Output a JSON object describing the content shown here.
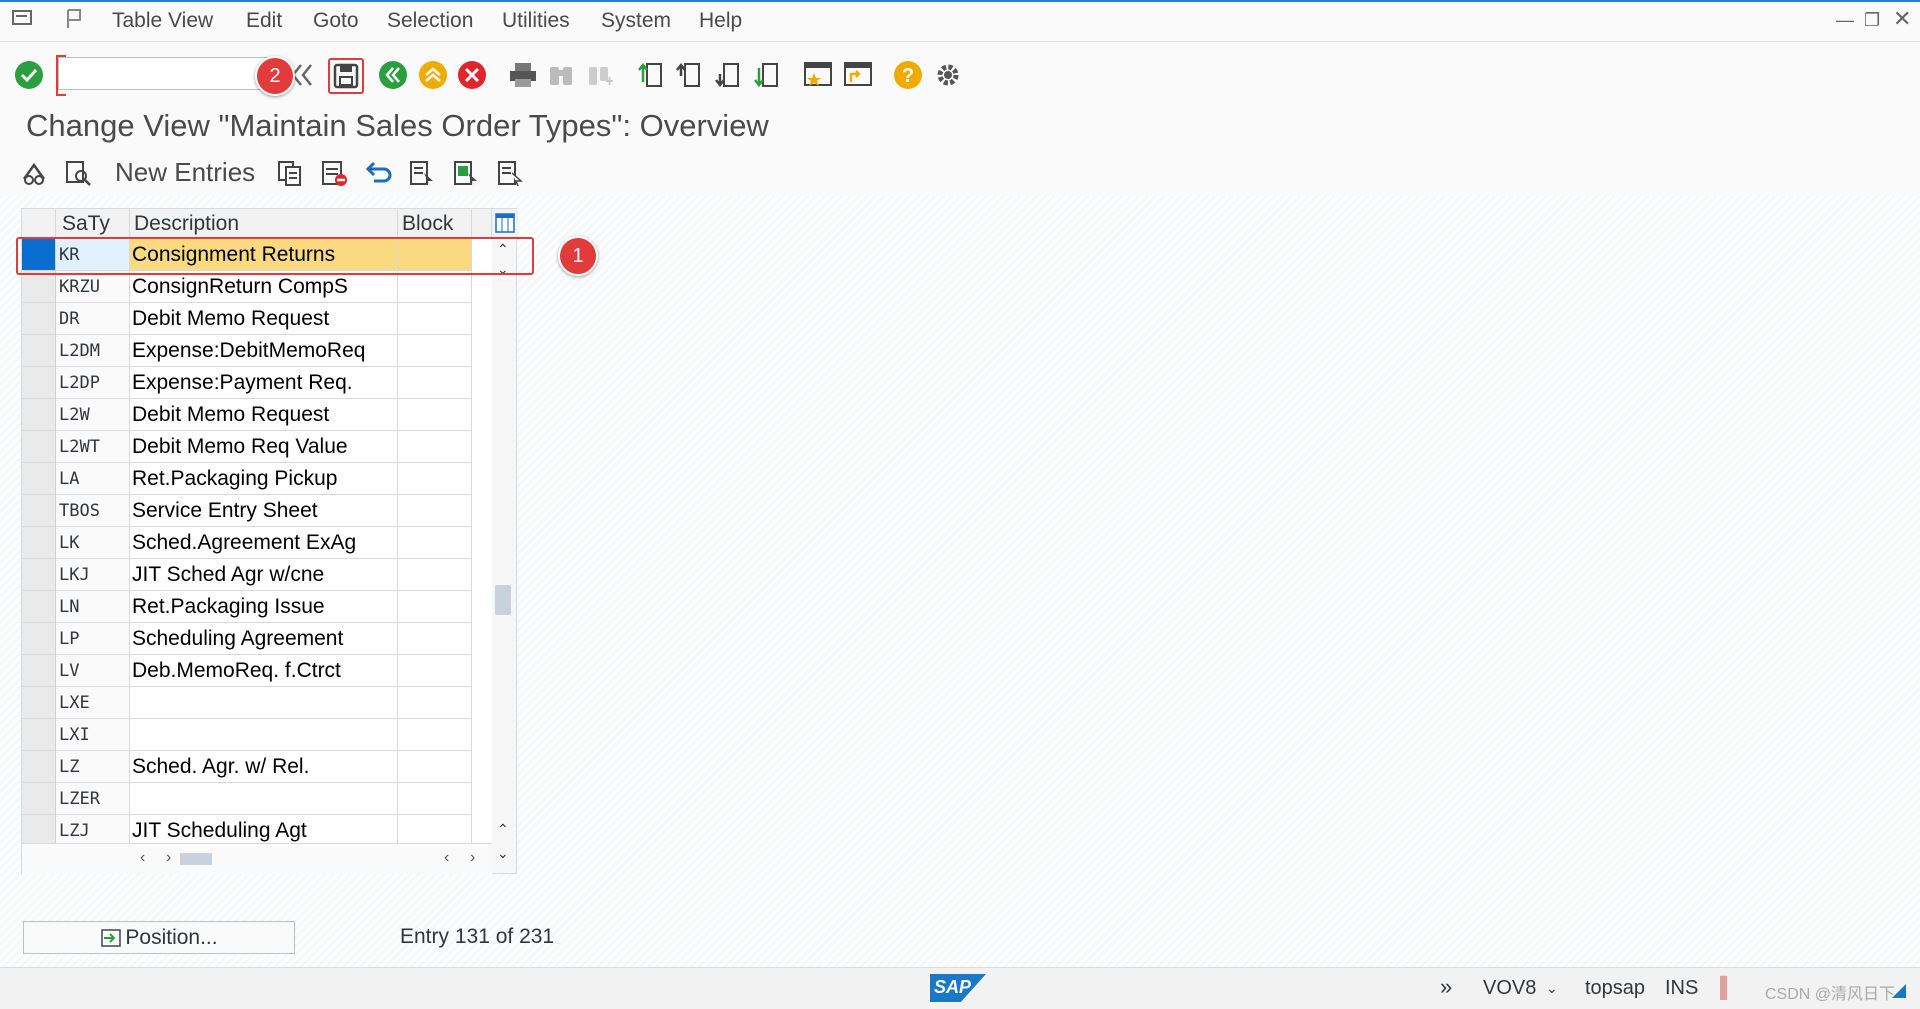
{
  "menu": {
    "items": [
      "Table View",
      "Edit",
      "Goto",
      "Selection",
      "Utilities",
      "System",
      "Help"
    ]
  },
  "command_field": {
    "value": "",
    "placeholder": ""
  },
  "badges": {
    "save": "2",
    "row": "1"
  },
  "title": "Change View \"Maintain Sales Order Types\": Overview",
  "app_toolbar": {
    "new_entries": "New Entries"
  },
  "table": {
    "headers": [
      "SaTy",
      "Description",
      "Block"
    ],
    "rows": [
      {
        "saty": "KR",
        "desc": "Consignment Returns",
        "block": ""
      },
      {
        "saty": "KRZU",
        "desc": "ConsignReturn CompS",
        "block": ""
      },
      {
        "saty": "DR",
        "desc": "Debit Memo Request",
        "block": ""
      },
      {
        "saty": "L2DM",
        "desc": "Expense:DebitMemoReq",
        "block": ""
      },
      {
        "saty": "L2DP",
        "desc": "Expense:Payment Req.",
        "block": ""
      },
      {
        "saty": "L2W",
        "desc": "Debit Memo Request",
        "block": ""
      },
      {
        "saty": "L2WT",
        "desc": "Debit Memo Req Value",
        "block": ""
      },
      {
        "saty": "LA",
        "desc": "Ret.Packaging Pickup",
        "block": ""
      },
      {
        "saty": "TBOS",
        "desc": "Service Entry Sheet",
        "block": ""
      },
      {
        "saty": "LK",
        "desc": "Sched.Agreement ExAg",
        "block": ""
      },
      {
        "saty": "LKJ",
        "desc": "JIT Sched Agr w/cne",
        "block": ""
      },
      {
        "saty": "LN",
        "desc": "Ret.Packaging Issue",
        "block": ""
      },
      {
        "saty": "LP",
        "desc": "Scheduling Agreement",
        "block": ""
      },
      {
        "saty": "LV",
        "desc": "Deb.MemoReq. f.Ctrct",
        "block": ""
      },
      {
        "saty": "LXE",
        "desc": "",
        "block": ""
      },
      {
        "saty": "LXI",
        "desc": "",
        "block": ""
      },
      {
        "saty": "LZ",
        "desc": "Sched. Agr. w/ Rel.",
        "block": ""
      },
      {
        "saty": "LZER",
        "desc": "",
        "block": ""
      },
      {
        "saty": "LZJ",
        "desc": "JIT Scheduling Agt",
        "block": ""
      }
    ]
  },
  "position_button": "Position...",
  "entry_info": "Entry 131 of 231",
  "status_bar": {
    "transaction": "VOV8",
    "system": "topsap",
    "mode": "INS",
    "watermark": "CSDN @清风日下"
  },
  "colors": {
    "selected_row": "#fad981",
    "selected_marker": "#0a6ed1",
    "annotation_red": "#e23b3b",
    "accent_green": "#2b9e3f",
    "accent_orange": "#f0ab00"
  }
}
